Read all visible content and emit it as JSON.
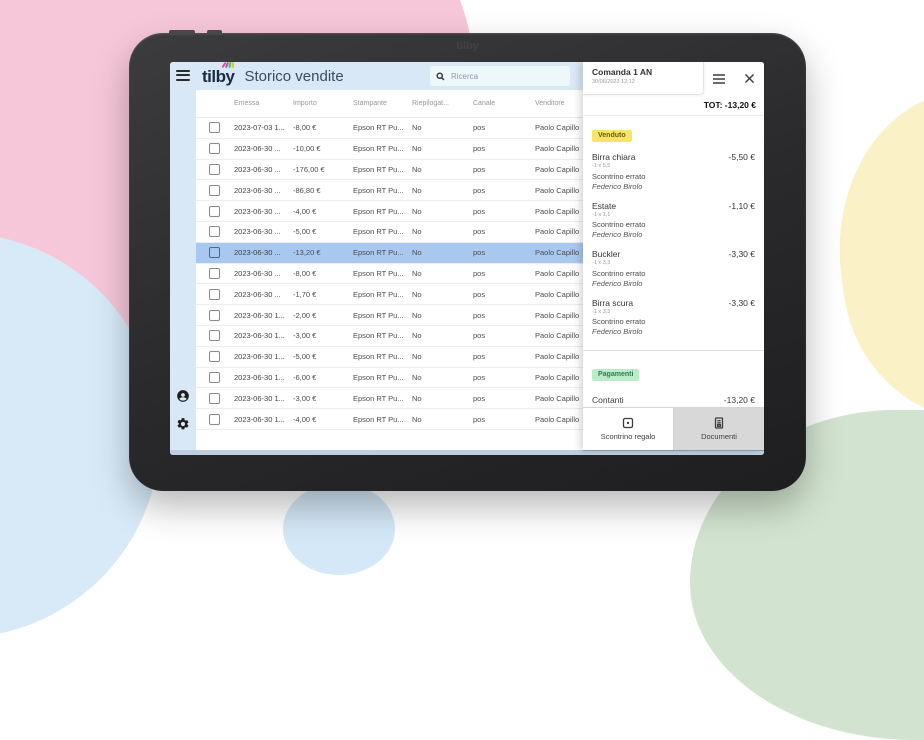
{
  "colors": {
    "header_bg": "#d9e8f6",
    "selected_row": "#a9c8f0",
    "venduto_badge_bg": "#f8e469",
    "pagamenti_badge_bg": "#b9edc9",
    "blob_pink": "#f6c7d9",
    "blob_blue": "#d8eaf8",
    "blob_yellow": "#fbf1c6",
    "blob_green": "#d2e4cf"
  },
  "icons": {
    "menu": "hamburger",
    "search": "magnifier",
    "close": "x",
    "account": "person-circle",
    "settings": "gear",
    "gift_receipt": "card-with-dot",
    "documents": "document-sheet"
  },
  "tablet": {
    "bezel_logo": "tilby"
  },
  "app": {
    "header": {
      "logo_text": "tilby",
      "title": "Storico vendite",
      "search_placeholder": "Ricerca"
    },
    "table": {
      "columns": [
        "Emessa",
        "Importo",
        "Stampante",
        "Riepilogat...",
        "Canale",
        "Venditore"
      ],
      "rows": [
        {
          "emessa": "2023-07-03 1...",
          "importo": "-8,00 €",
          "stampante": "Epson RT Pu...",
          "riepilogato": "No",
          "canale": "pos",
          "venditore": "Paolo Capillo",
          "selected": false
        },
        {
          "emessa": "2023-06-30 ...",
          "importo": "-10,00 €",
          "stampante": "Epson RT Pu...",
          "riepilogato": "No",
          "canale": "pos",
          "venditore": "Paolo Capillo",
          "selected": false
        },
        {
          "emessa": "2023-06-30 ...",
          "importo": "-176,00 €",
          "stampante": "Epson RT Pu...",
          "riepilogato": "No",
          "canale": "pos",
          "venditore": "Paolo Capillo",
          "selected": false
        },
        {
          "emessa": "2023-06-30 ...",
          "importo": "-86,80 €",
          "stampante": "Epson RT Pu...",
          "riepilogato": "No",
          "canale": "pos",
          "venditore": "Paolo Capillo",
          "selected": false
        },
        {
          "emessa": "2023-06-30 ...",
          "importo": "-4,00 €",
          "stampante": "Epson RT Pu...",
          "riepilogato": "No",
          "canale": "pos",
          "venditore": "Paolo Capillo",
          "selected": false
        },
        {
          "emessa": "2023-06-30 ...",
          "importo": "-5,00 €",
          "stampante": "Epson RT Pu...",
          "riepilogato": "No",
          "canale": "pos",
          "venditore": "Paolo Capillo",
          "selected": false
        },
        {
          "emessa": "2023-06-30 ...",
          "importo": "-13,20 €",
          "stampante": "Epson RT Pu...",
          "riepilogato": "No",
          "canale": "pos",
          "venditore": "Paolo Capillo",
          "selected": true
        },
        {
          "emessa": "2023-06-30 ...",
          "importo": "-8,00 €",
          "stampante": "Epson RT Pu...",
          "riepilogato": "No",
          "canale": "pos",
          "venditore": "Paolo Capillo",
          "selected": false
        },
        {
          "emessa": "2023-06-30 ...",
          "importo": "-1,70 €",
          "stampante": "Epson RT Pu...",
          "riepilogato": "No",
          "canale": "pos",
          "venditore": "Paolo Capillo",
          "selected": false
        },
        {
          "emessa": "2023-06-30 1...",
          "importo": "-2,00 €",
          "stampante": "Epson RT Pu...",
          "riepilogato": "No",
          "canale": "pos",
          "venditore": "Paolo Capillo",
          "selected": false
        },
        {
          "emessa": "2023-06-30 1...",
          "importo": "-3,00 €",
          "stampante": "Epson RT Pu...",
          "riepilogato": "No",
          "canale": "pos",
          "venditore": "Paolo Capillo",
          "selected": false
        },
        {
          "emessa": "2023-06-30 1...",
          "importo": "-5,00 €",
          "stampante": "Epson RT Pu...",
          "riepilogato": "No",
          "canale": "pos",
          "venditore": "Paolo Capillo",
          "selected": false
        },
        {
          "emessa": "2023-06-30 1...",
          "importo": "-6,00 €",
          "stampante": "Epson RT Pu...",
          "riepilogato": "No",
          "canale": "pos",
          "venditore": "Paolo Capillo",
          "selected": false
        },
        {
          "emessa": "2023-06-30 1...",
          "importo": "-3,00 €",
          "stampante": "Epson RT Pu...",
          "riepilogato": "No",
          "canale": "pos",
          "venditore": "Paolo Capillo",
          "selected": false
        },
        {
          "emessa": "2023-06-30 1...",
          "importo": "-4,00 €",
          "stampante": "Epson RT Pu...",
          "riepilogato": "No",
          "canale": "pos",
          "venditore": "Paolo Capillo",
          "selected": false
        }
      ]
    },
    "panel": {
      "title": "Comanda 1 AN",
      "subtitle": "30/06/2023 12:12",
      "total": "TOT: -13,20 €",
      "venduto": {
        "badge": "Venduto",
        "items": [
          {
            "name": "Birra chiara",
            "price": "-5,50 €",
            "qty": "-1 x 5,5",
            "note": "Scontrino errato",
            "operator": "Federico Birolo"
          },
          {
            "name": "Estate",
            "price": "-1,10 €",
            "qty": "-1 x 1,1",
            "note": "Scontrino errato",
            "operator": "Federico Birolo"
          },
          {
            "name": "Buckler",
            "price": "-3,30 €",
            "qty": "-1 x 3,3",
            "note": "Scontrino errato",
            "operator": "Federico Birolo"
          },
          {
            "name": "Birra scura",
            "price": "-3,30 €",
            "qty": "-1 x 3,3",
            "note": "Scontrino errato",
            "operator": "Federico Birolo"
          }
        ]
      },
      "pagamenti": {
        "badge": "Pagamenti",
        "entries": [
          {
            "label": "Contanti",
            "amount": "-13,20 €"
          }
        ]
      },
      "footer_buttons": [
        {
          "label": "Scontrino regalo",
          "active": false
        },
        {
          "label": "Documenti",
          "active": true
        }
      ]
    }
  }
}
